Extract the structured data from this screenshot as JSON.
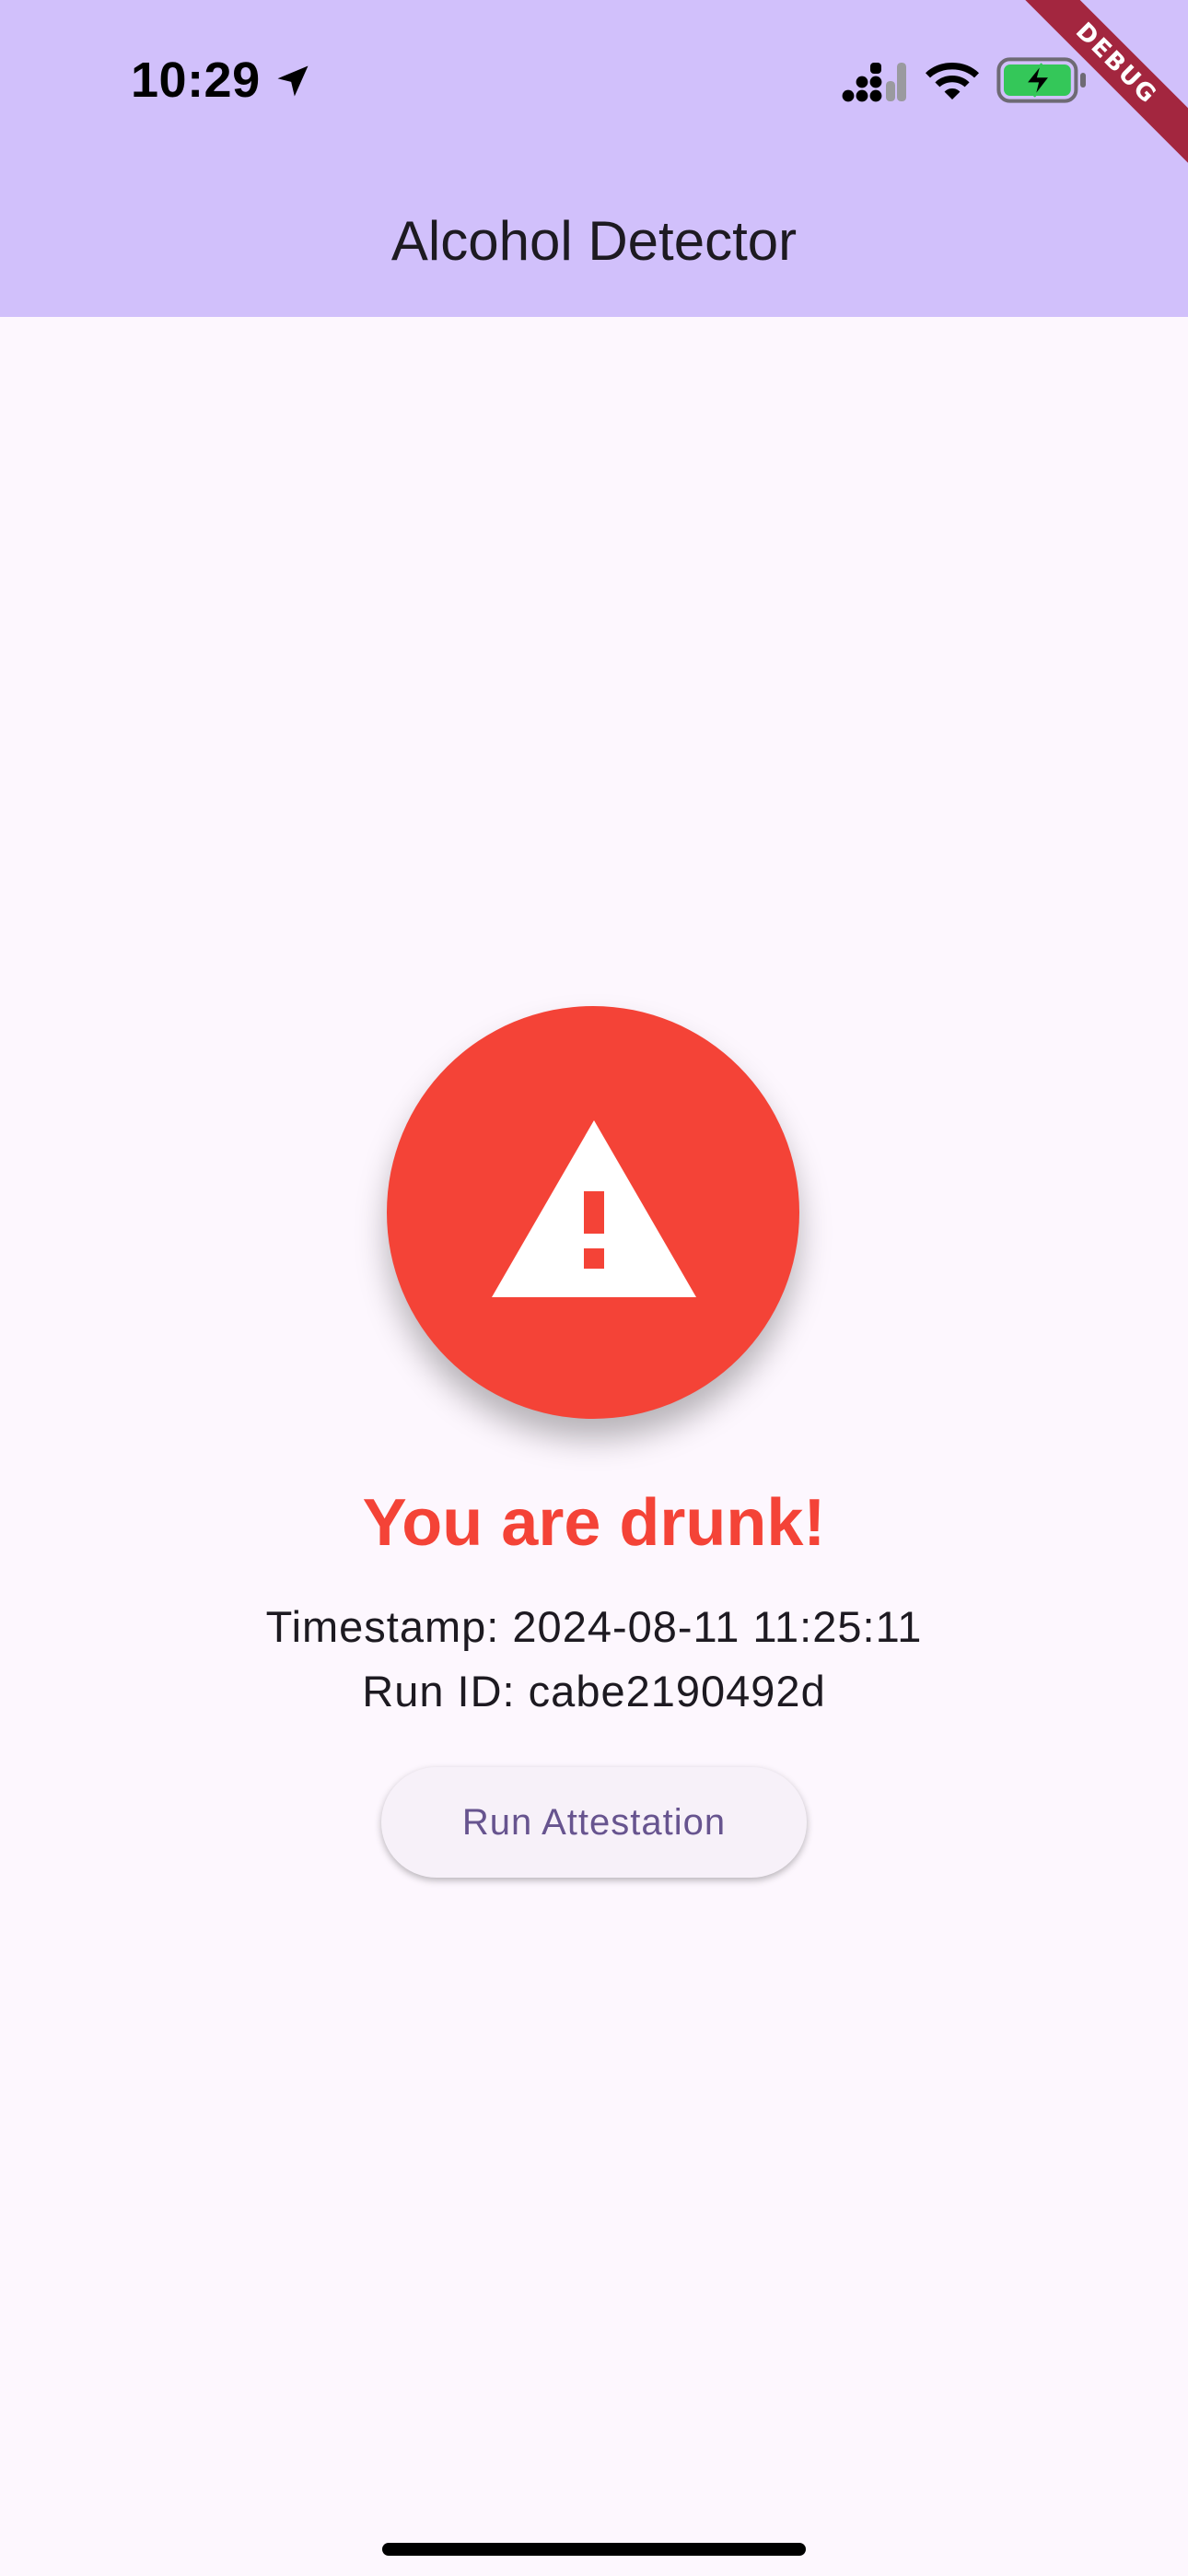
{
  "status_bar": {
    "time": "10:29",
    "icons": [
      "location-arrow-icon",
      "cellular-signal-icon",
      "wifi-icon",
      "battery-charging-icon"
    ]
  },
  "debug_banner": {
    "label": "DEBUG"
  },
  "app_bar": {
    "title": "Alcohol Detector"
  },
  "result": {
    "icon": "warning-icon",
    "title": "You are drunk!",
    "timestamp": "Timestamp: 2024-08-11 11:25:11",
    "run_id": "Run ID: cabe2190492d"
  },
  "actions": {
    "run_attestation_label": "Run Attestation"
  },
  "colors": {
    "app_bar": "#d1c0fb",
    "background": "#fdf7fe",
    "alert_red": "#f44337",
    "button_text": "#67548f",
    "debug_ribbon": "#a3263f"
  }
}
